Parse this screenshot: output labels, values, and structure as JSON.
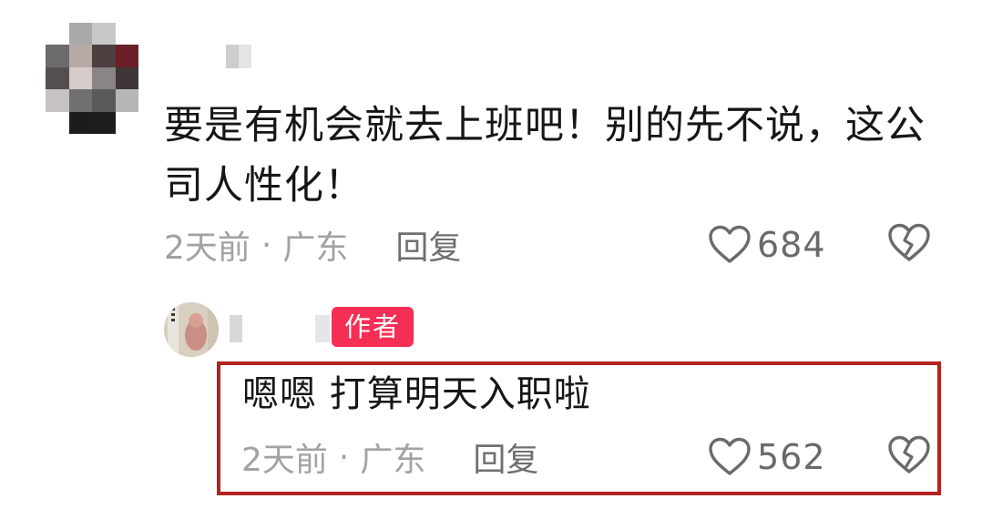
{
  "comment": {
    "text": "要是有机会就去上班吧！别的先不说，这公司人性化！",
    "time": "2天前",
    "separator": "·",
    "location": "广东",
    "reply_label": "回复",
    "like_count": "684",
    "icons": {
      "like": "heart-outline-icon",
      "dislike": "broken-heart-icon"
    }
  },
  "reply": {
    "badge": "作者",
    "text": "嗯嗯 打算明天入职啦",
    "time": "2天前",
    "separator": "·",
    "location": "广东",
    "reply_label": "回复",
    "like_count": "562",
    "icons": {
      "like": "heart-outline-icon",
      "dislike": "broken-heart-icon"
    }
  },
  "colors": {
    "text": "#161616",
    "meta": "#a2a2a2",
    "badge": "#f42e54",
    "highlight_border": "#b3231f"
  }
}
